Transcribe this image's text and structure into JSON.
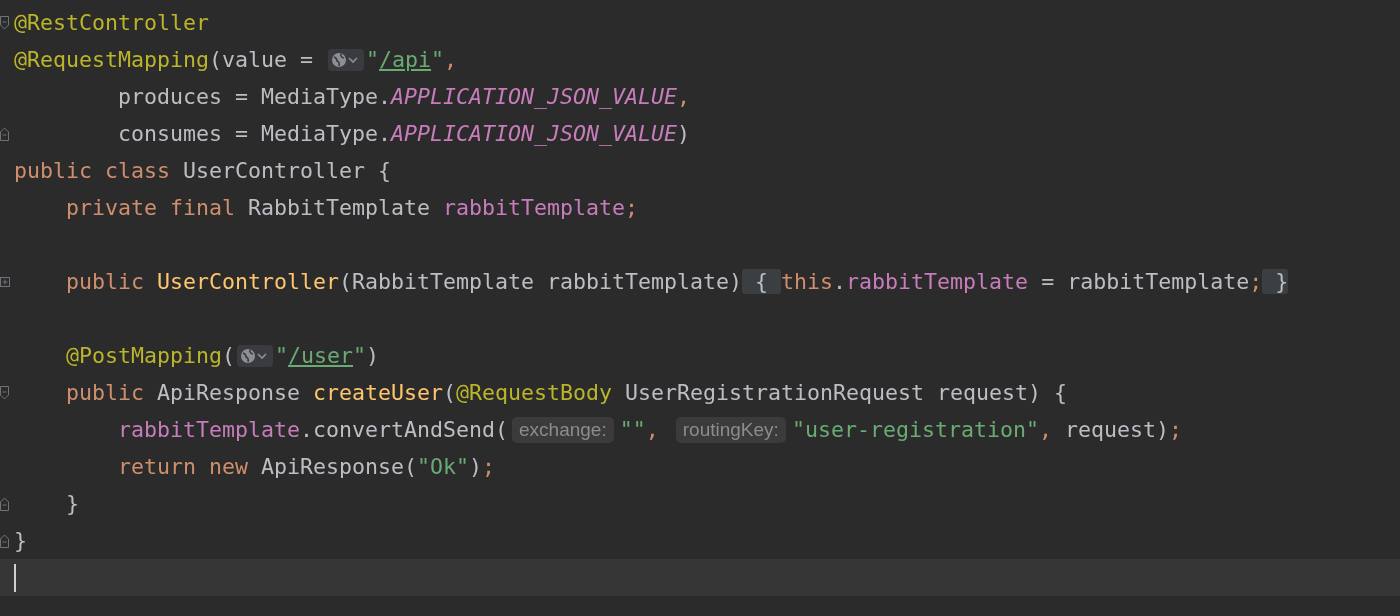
{
  "editor": {
    "lines": [
      {
        "fold_start": true,
        "fold_end": false,
        "collapsed": false,
        "current": false,
        "tokens": [
          {
            "kind": "ann",
            "text": "@RestController"
          }
        ]
      },
      {
        "fold_start": false,
        "fold_end": false,
        "collapsed": false,
        "current": false,
        "tokens": [
          {
            "kind": "ann",
            "text": "@RequestMapping"
          },
          {
            "kind": "plain",
            "text": "(value = "
          },
          {
            "kind": "globe"
          },
          {
            "kind": "str",
            "text": "\""
          },
          {
            "kind": "link",
            "text": "/api"
          },
          {
            "kind": "str",
            "text": "\""
          },
          {
            "kind": "kw",
            "text": ","
          }
        ]
      },
      {
        "fold_start": false,
        "fold_end": false,
        "collapsed": false,
        "current": false,
        "tokens": [
          {
            "kind": "plain",
            "text": "        produces = MediaType."
          },
          {
            "kind": "const",
            "text": "APPLICATION_JSON_VALUE"
          },
          {
            "kind": "kw",
            "text": ","
          }
        ]
      },
      {
        "fold_start": false,
        "fold_end": true,
        "collapsed": false,
        "current": false,
        "tokens": [
          {
            "kind": "plain",
            "text": "        consumes = MediaType."
          },
          {
            "kind": "const",
            "text": "APPLICATION_JSON_VALUE"
          },
          {
            "kind": "plain",
            "text": ")"
          }
        ]
      },
      {
        "fold_start": false,
        "fold_end": false,
        "collapsed": false,
        "current": false,
        "tokens": [
          {
            "kind": "kw",
            "text": "public class"
          },
          {
            "kind": "plain",
            "text": " UserController {"
          }
        ]
      },
      {
        "fold_start": false,
        "fold_end": false,
        "collapsed": false,
        "current": false,
        "tokens": [
          {
            "kind": "kw",
            "text": "    private final"
          },
          {
            "kind": "plain",
            "text": " RabbitTemplate "
          },
          {
            "kind": "field",
            "text": "rabbitTemplate"
          },
          {
            "kind": "kw",
            "text": ";"
          }
        ]
      },
      {
        "fold_start": false,
        "fold_end": false,
        "collapsed": false,
        "current": false
      },
      {
        "fold_start": false,
        "fold_end": false,
        "collapsed": true,
        "current": false,
        "tokens": [
          {
            "kind": "kw",
            "text": "    public "
          },
          {
            "kind": "method",
            "text": "UserController"
          },
          {
            "kind": "plain",
            "text": "(RabbitTemplate rabbitTemplate)"
          },
          {
            "kind": "folded",
            "text": " { "
          },
          {
            "kind": "kw",
            "text": "this"
          },
          {
            "kind": "plain",
            "text": "."
          },
          {
            "kind": "field",
            "text": "rabbitTemplate"
          },
          {
            "kind": "plain",
            "text": " = rabbitTemplate"
          },
          {
            "kind": "kw",
            "text": ";"
          },
          {
            "kind": "folded",
            "text": " }"
          }
        ]
      },
      {
        "fold_start": false,
        "fold_end": false,
        "collapsed": false,
        "current": false
      },
      {
        "fold_start": false,
        "fold_end": false,
        "collapsed": false,
        "current": false,
        "tokens": [
          {
            "kind": "ann",
            "text": "    @PostMapping"
          },
          {
            "kind": "plain",
            "text": "("
          },
          {
            "kind": "globe"
          },
          {
            "kind": "str",
            "text": "\""
          },
          {
            "kind": "link",
            "text": "/user"
          },
          {
            "kind": "str",
            "text": "\""
          },
          {
            "kind": "plain",
            "text": ")"
          }
        ]
      },
      {
        "fold_start": true,
        "fold_end": false,
        "collapsed": false,
        "current": false,
        "tokens": [
          {
            "kind": "kw",
            "text": "    public"
          },
          {
            "kind": "plain",
            "text": " ApiResponse "
          },
          {
            "kind": "method",
            "text": "createUser"
          },
          {
            "kind": "plain",
            "text": "("
          },
          {
            "kind": "ann",
            "text": "@RequestBody"
          },
          {
            "kind": "plain",
            "text": " UserRegistrationRequest request) {"
          }
        ]
      },
      {
        "fold_start": false,
        "fold_end": false,
        "collapsed": false,
        "current": false,
        "tokens": [
          {
            "kind": "field",
            "text": "        rabbitTemplate"
          },
          {
            "kind": "plain",
            "text": ".convertAndSend("
          },
          {
            "kind": "hint",
            "text": "exchange:"
          },
          {
            "kind": "str",
            "text": "\"\""
          },
          {
            "kind": "kw",
            "text": ", "
          },
          {
            "kind": "hint",
            "text": "routingKey:"
          },
          {
            "kind": "str",
            "text": "\"user-registration\""
          },
          {
            "kind": "kw",
            "text": ","
          },
          {
            "kind": "plain",
            "text": " request)"
          },
          {
            "kind": "kw",
            "text": ";"
          }
        ]
      },
      {
        "fold_start": false,
        "fold_end": false,
        "collapsed": false,
        "current": false,
        "tokens": [
          {
            "kind": "kw",
            "text": "        return new"
          },
          {
            "kind": "plain",
            "text": " ApiResponse("
          },
          {
            "kind": "str",
            "text": "\"Ok\""
          },
          {
            "kind": "plain",
            "text": ")"
          },
          {
            "kind": "kw",
            "text": ";"
          }
        ]
      },
      {
        "fold_start": false,
        "fold_end": true,
        "collapsed": false,
        "current": false,
        "tokens": [
          {
            "kind": "plain",
            "text": "    }"
          }
        ]
      },
      {
        "fold_start": false,
        "fold_end": true,
        "collapsed": false,
        "current": false,
        "tokens": [
          {
            "kind": "plain",
            "text": "}"
          }
        ]
      },
      {
        "fold_start": false,
        "fold_end": false,
        "collapsed": false,
        "current": true
      }
    ]
  }
}
